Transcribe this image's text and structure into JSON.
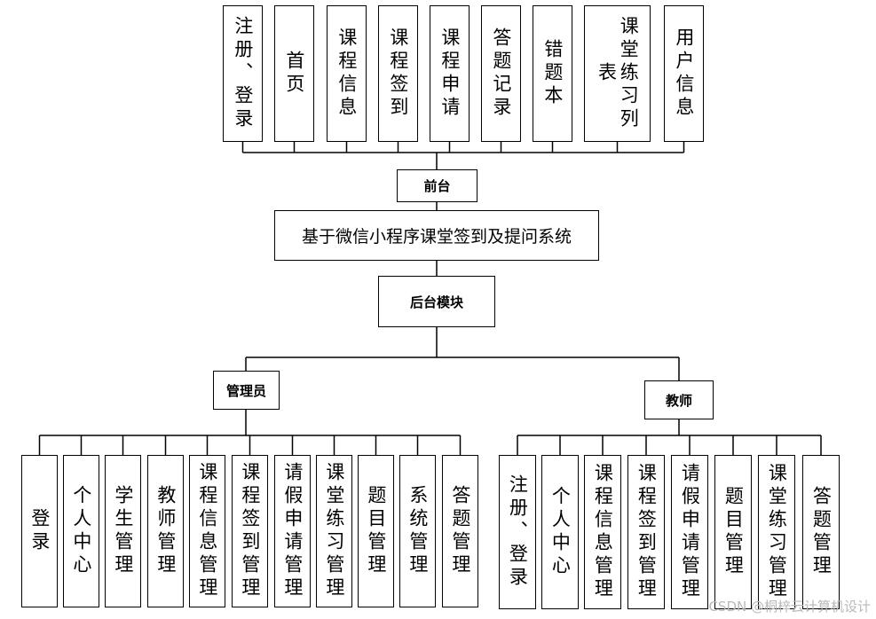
{
  "system": {
    "title": "基于微信小程序课堂签到及提问系统"
  },
  "frontend": {
    "label": "前台",
    "items": [
      "注册、登录",
      "首页",
      "课程信息",
      "课程签到",
      "课程申请",
      "答题记录",
      "错题本",
      "课堂练习列表",
      "用户信息"
    ]
  },
  "backend": {
    "label": "后台模块"
  },
  "admin": {
    "label": "管理员",
    "items": [
      "登录",
      "个人中心",
      "学生管理",
      "教师管理",
      "课程信息管理",
      "课程签到管理",
      "请假申请管理",
      "课堂练习管理",
      "题目管理",
      "系统管理",
      "答题管理"
    ]
  },
  "teacher": {
    "label": "教师",
    "items": [
      "注册、登录",
      "个人中心",
      "课程信息管理",
      "课程签到管理",
      "请假申请管理",
      "题目管理",
      "课堂练习管理",
      "答题管理"
    ]
  },
  "watermark": "CSDN @桐梓云计算机设计"
}
